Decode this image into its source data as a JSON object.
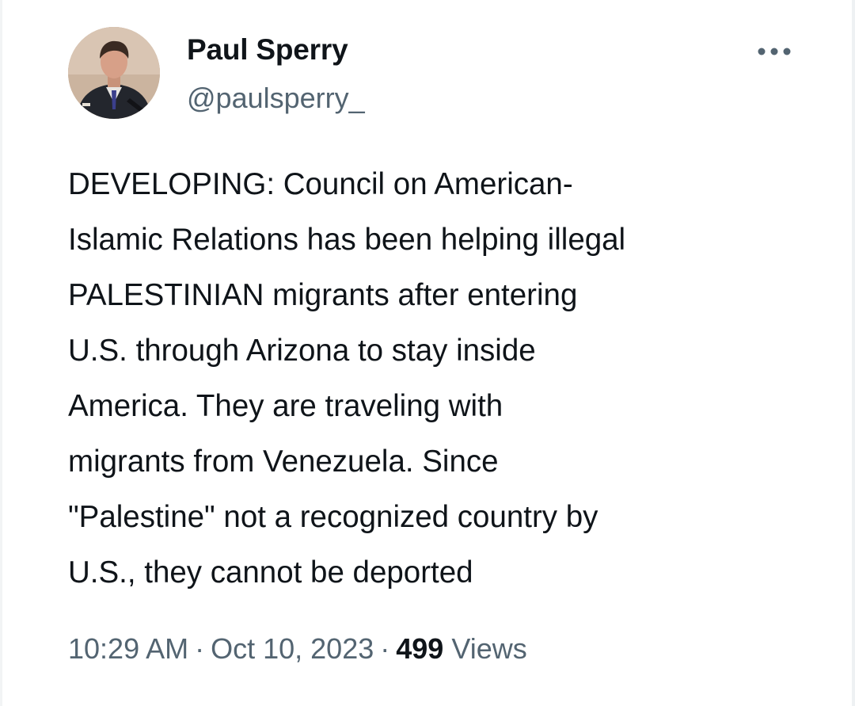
{
  "author": {
    "name": "Paul Sperry",
    "handle": "@paulsperry_"
  },
  "tweet": {
    "lines": [
      "DEVELOPING: Council on American-",
      "Islamic Relations has been helping illegal",
      "PALESTINIAN migrants after entering",
      "U.S. through Arizona to stay inside",
      "America. They are traveling with",
      "migrants from Venezuela. Since",
      "\"Palestine\" not a recognized country by",
      "U.S., they cannot be deported"
    ]
  },
  "meta": {
    "time": "10:29 AM",
    "separator": "·",
    "date": "Oct 10, 2023",
    "views_count": "499",
    "views_label": "Views"
  },
  "icons": {
    "more": "more-horizontal-icon",
    "avatar": "profile-photo"
  },
  "colors": {
    "text_primary": "#0f1419",
    "text_secondary": "#536471",
    "background": "#ffffff"
  }
}
